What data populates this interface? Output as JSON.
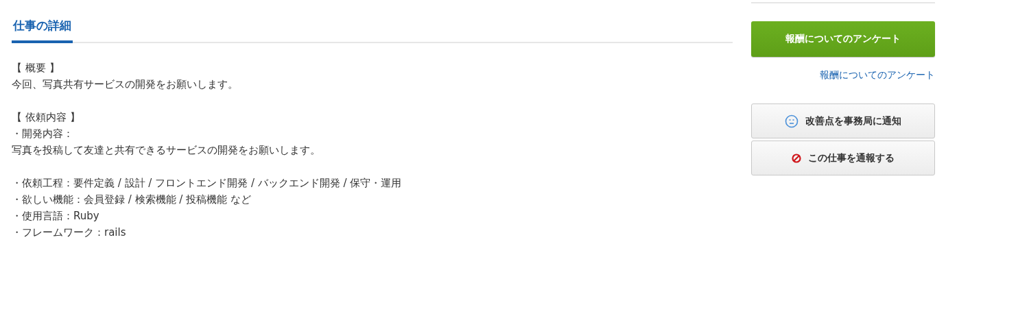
{
  "section": {
    "title": "仕事の詳細",
    "paragraphs": [
      [
        "【 概要 】",
        "今回、写真共有サービスの開発をお願いします。"
      ],
      [
        "【 依頼内容 】",
        "・開発内容：",
        "写真を投稿して友達と共有できるサービスの開発をお願いします。"
      ],
      [
        "・依頼工程：要件定義 / 設計 / フロントエンド開発 / バックエンド開発 / 保守・運用",
        "・欲しい機能：会員登録 / 検索機能 / 投稿機能 など",
        "・使用言語：Ruby",
        "・フレームワーク：rails"
      ]
    ]
  },
  "sidebar": {
    "actions": [
      {
        "kind": "primary",
        "label": "報酬についてのアンケート"
      },
      {
        "kind": "link",
        "label": "報酬についてのアンケート"
      },
      {
        "kind": "feedback",
        "label": "改善点を事務局に通知"
      },
      {
        "kind": "report",
        "label": "この仕事を通報する"
      }
    ]
  }
}
